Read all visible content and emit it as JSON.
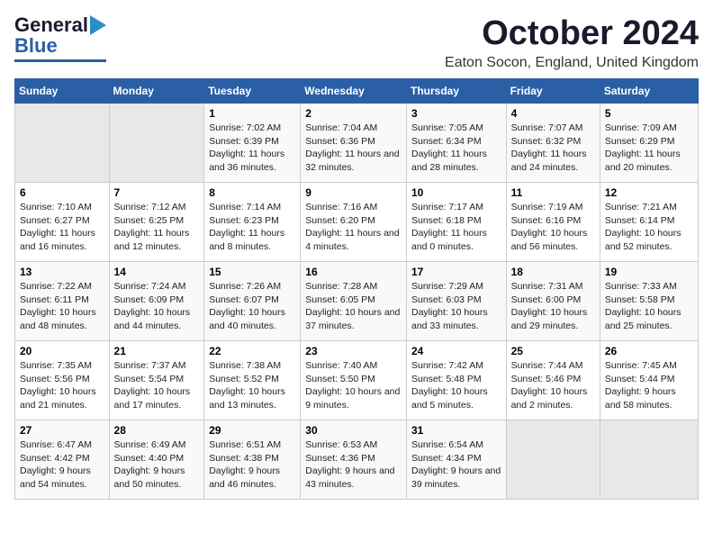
{
  "header": {
    "logo_line1": "General",
    "logo_line2": "Blue",
    "title": "October 2024",
    "subtitle": "Eaton Socon, England, United Kingdom"
  },
  "weekdays": [
    "Sunday",
    "Monday",
    "Tuesday",
    "Wednesday",
    "Thursday",
    "Friday",
    "Saturday"
  ],
  "weeks": [
    [
      {
        "day": "",
        "sunrise": "",
        "sunset": "",
        "daylight": ""
      },
      {
        "day": "",
        "sunrise": "",
        "sunset": "",
        "daylight": ""
      },
      {
        "day": "1",
        "sunrise": "Sunrise: 7:02 AM",
        "sunset": "Sunset: 6:39 PM",
        "daylight": "Daylight: 11 hours and 36 minutes."
      },
      {
        "day": "2",
        "sunrise": "Sunrise: 7:04 AM",
        "sunset": "Sunset: 6:36 PM",
        "daylight": "Daylight: 11 hours and 32 minutes."
      },
      {
        "day": "3",
        "sunrise": "Sunrise: 7:05 AM",
        "sunset": "Sunset: 6:34 PM",
        "daylight": "Daylight: 11 hours and 28 minutes."
      },
      {
        "day": "4",
        "sunrise": "Sunrise: 7:07 AM",
        "sunset": "Sunset: 6:32 PM",
        "daylight": "Daylight: 11 hours and 24 minutes."
      },
      {
        "day": "5",
        "sunrise": "Sunrise: 7:09 AM",
        "sunset": "Sunset: 6:29 PM",
        "daylight": "Daylight: 11 hours and 20 minutes."
      }
    ],
    [
      {
        "day": "6",
        "sunrise": "Sunrise: 7:10 AM",
        "sunset": "Sunset: 6:27 PM",
        "daylight": "Daylight: 11 hours and 16 minutes."
      },
      {
        "day": "7",
        "sunrise": "Sunrise: 7:12 AM",
        "sunset": "Sunset: 6:25 PM",
        "daylight": "Daylight: 11 hours and 12 minutes."
      },
      {
        "day": "8",
        "sunrise": "Sunrise: 7:14 AM",
        "sunset": "Sunset: 6:23 PM",
        "daylight": "Daylight: 11 hours and 8 minutes."
      },
      {
        "day": "9",
        "sunrise": "Sunrise: 7:16 AM",
        "sunset": "Sunset: 6:20 PM",
        "daylight": "Daylight: 11 hours and 4 minutes."
      },
      {
        "day": "10",
        "sunrise": "Sunrise: 7:17 AM",
        "sunset": "Sunset: 6:18 PM",
        "daylight": "Daylight: 11 hours and 0 minutes."
      },
      {
        "day": "11",
        "sunrise": "Sunrise: 7:19 AM",
        "sunset": "Sunset: 6:16 PM",
        "daylight": "Daylight: 10 hours and 56 minutes."
      },
      {
        "day": "12",
        "sunrise": "Sunrise: 7:21 AM",
        "sunset": "Sunset: 6:14 PM",
        "daylight": "Daylight: 10 hours and 52 minutes."
      }
    ],
    [
      {
        "day": "13",
        "sunrise": "Sunrise: 7:22 AM",
        "sunset": "Sunset: 6:11 PM",
        "daylight": "Daylight: 10 hours and 48 minutes."
      },
      {
        "day": "14",
        "sunrise": "Sunrise: 7:24 AM",
        "sunset": "Sunset: 6:09 PM",
        "daylight": "Daylight: 10 hours and 44 minutes."
      },
      {
        "day": "15",
        "sunrise": "Sunrise: 7:26 AM",
        "sunset": "Sunset: 6:07 PM",
        "daylight": "Daylight: 10 hours and 40 minutes."
      },
      {
        "day": "16",
        "sunrise": "Sunrise: 7:28 AM",
        "sunset": "Sunset: 6:05 PM",
        "daylight": "Daylight: 10 hours and 37 minutes."
      },
      {
        "day": "17",
        "sunrise": "Sunrise: 7:29 AM",
        "sunset": "Sunset: 6:03 PM",
        "daylight": "Daylight: 10 hours and 33 minutes."
      },
      {
        "day": "18",
        "sunrise": "Sunrise: 7:31 AM",
        "sunset": "Sunset: 6:00 PM",
        "daylight": "Daylight: 10 hours and 29 minutes."
      },
      {
        "day": "19",
        "sunrise": "Sunrise: 7:33 AM",
        "sunset": "Sunset: 5:58 PM",
        "daylight": "Daylight: 10 hours and 25 minutes."
      }
    ],
    [
      {
        "day": "20",
        "sunrise": "Sunrise: 7:35 AM",
        "sunset": "Sunset: 5:56 PM",
        "daylight": "Daylight: 10 hours and 21 minutes."
      },
      {
        "day": "21",
        "sunrise": "Sunrise: 7:37 AM",
        "sunset": "Sunset: 5:54 PM",
        "daylight": "Daylight: 10 hours and 17 minutes."
      },
      {
        "day": "22",
        "sunrise": "Sunrise: 7:38 AM",
        "sunset": "Sunset: 5:52 PM",
        "daylight": "Daylight: 10 hours and 13 minutes."
      },
      {
        "day": "23",
        "sunrise": "Sunrise: 7:40 AM",
        "sunset": "Sunset: 5:50 PM",
        "daylight": "Daylight: 10 hours and 9 minutes."
      },
      {
        "day": "24",
        "sunrise": "Sunrise: 7:42 AM",
        "sunset": "Sunset: 5:48 PM",
        "daylight": "Daylight: 10 hours and 5 minutes."
      },
      {
        "day": "25",
        "sunrise": "Sunrise: 7:44 AM",
        "sunset": "Sunset: 5:46 PM",
        "daylight": "Daylight: 10 hours and 2 minutes."
      },
      {
        "day": "26",
        "sunrise": "Sunrise: 7:45 AM",
        "sunset": "Sunset: 5:44 PM",
        "daylight": "Daylight: 9 hours and 58 minutes."
      }
    ],
    [
      {
        "day": "27",
        "sunrise": "Sunrise: 6:47 AM",
        "sunset": "Sunset: 4:42 PM",
        "daylight": "Daylight: 9 hours and 54 minutes."
      },
      {
        "day": "28",
        "sunrise": "Sunrise: 6:49 AM",
        "sunset": "Sunset: 4:40 PM",
        "daylight": "Daylight: 9 hours and 50 minutes."
      },
      {
        "day": "29",
        "sunrise": "Sunrise: 6:51 AM",
        "sunset": "Sunset: 4:38 PM",
        "daylight": "Daylight: 9 hours and 46 minutes."
      },
      {
        "day": "30",
        "sunrise": "Sunrise: 6:53 AM",
        "sunset": "Sunset: 4:36 PM",
        "daylight": "Daylight: 9 hours and 43 minutes."
      },
      {
        "day": "31",
        "sunrise": "Sunrise: 6:54 AM",
        "sunset": "Sunset: 4:34 PM",
        "daylight": "Daylight: 9 hours and 39 minutes."
      },
      {
        "day": "",
        "sunrise": "",
        "sunset": "",
        "daylight": ""
      },
      {
        "day": "",
        "sunrise": "",
        "sunset": "",
        "daylight": ""
      }
    ]
  ]
}
